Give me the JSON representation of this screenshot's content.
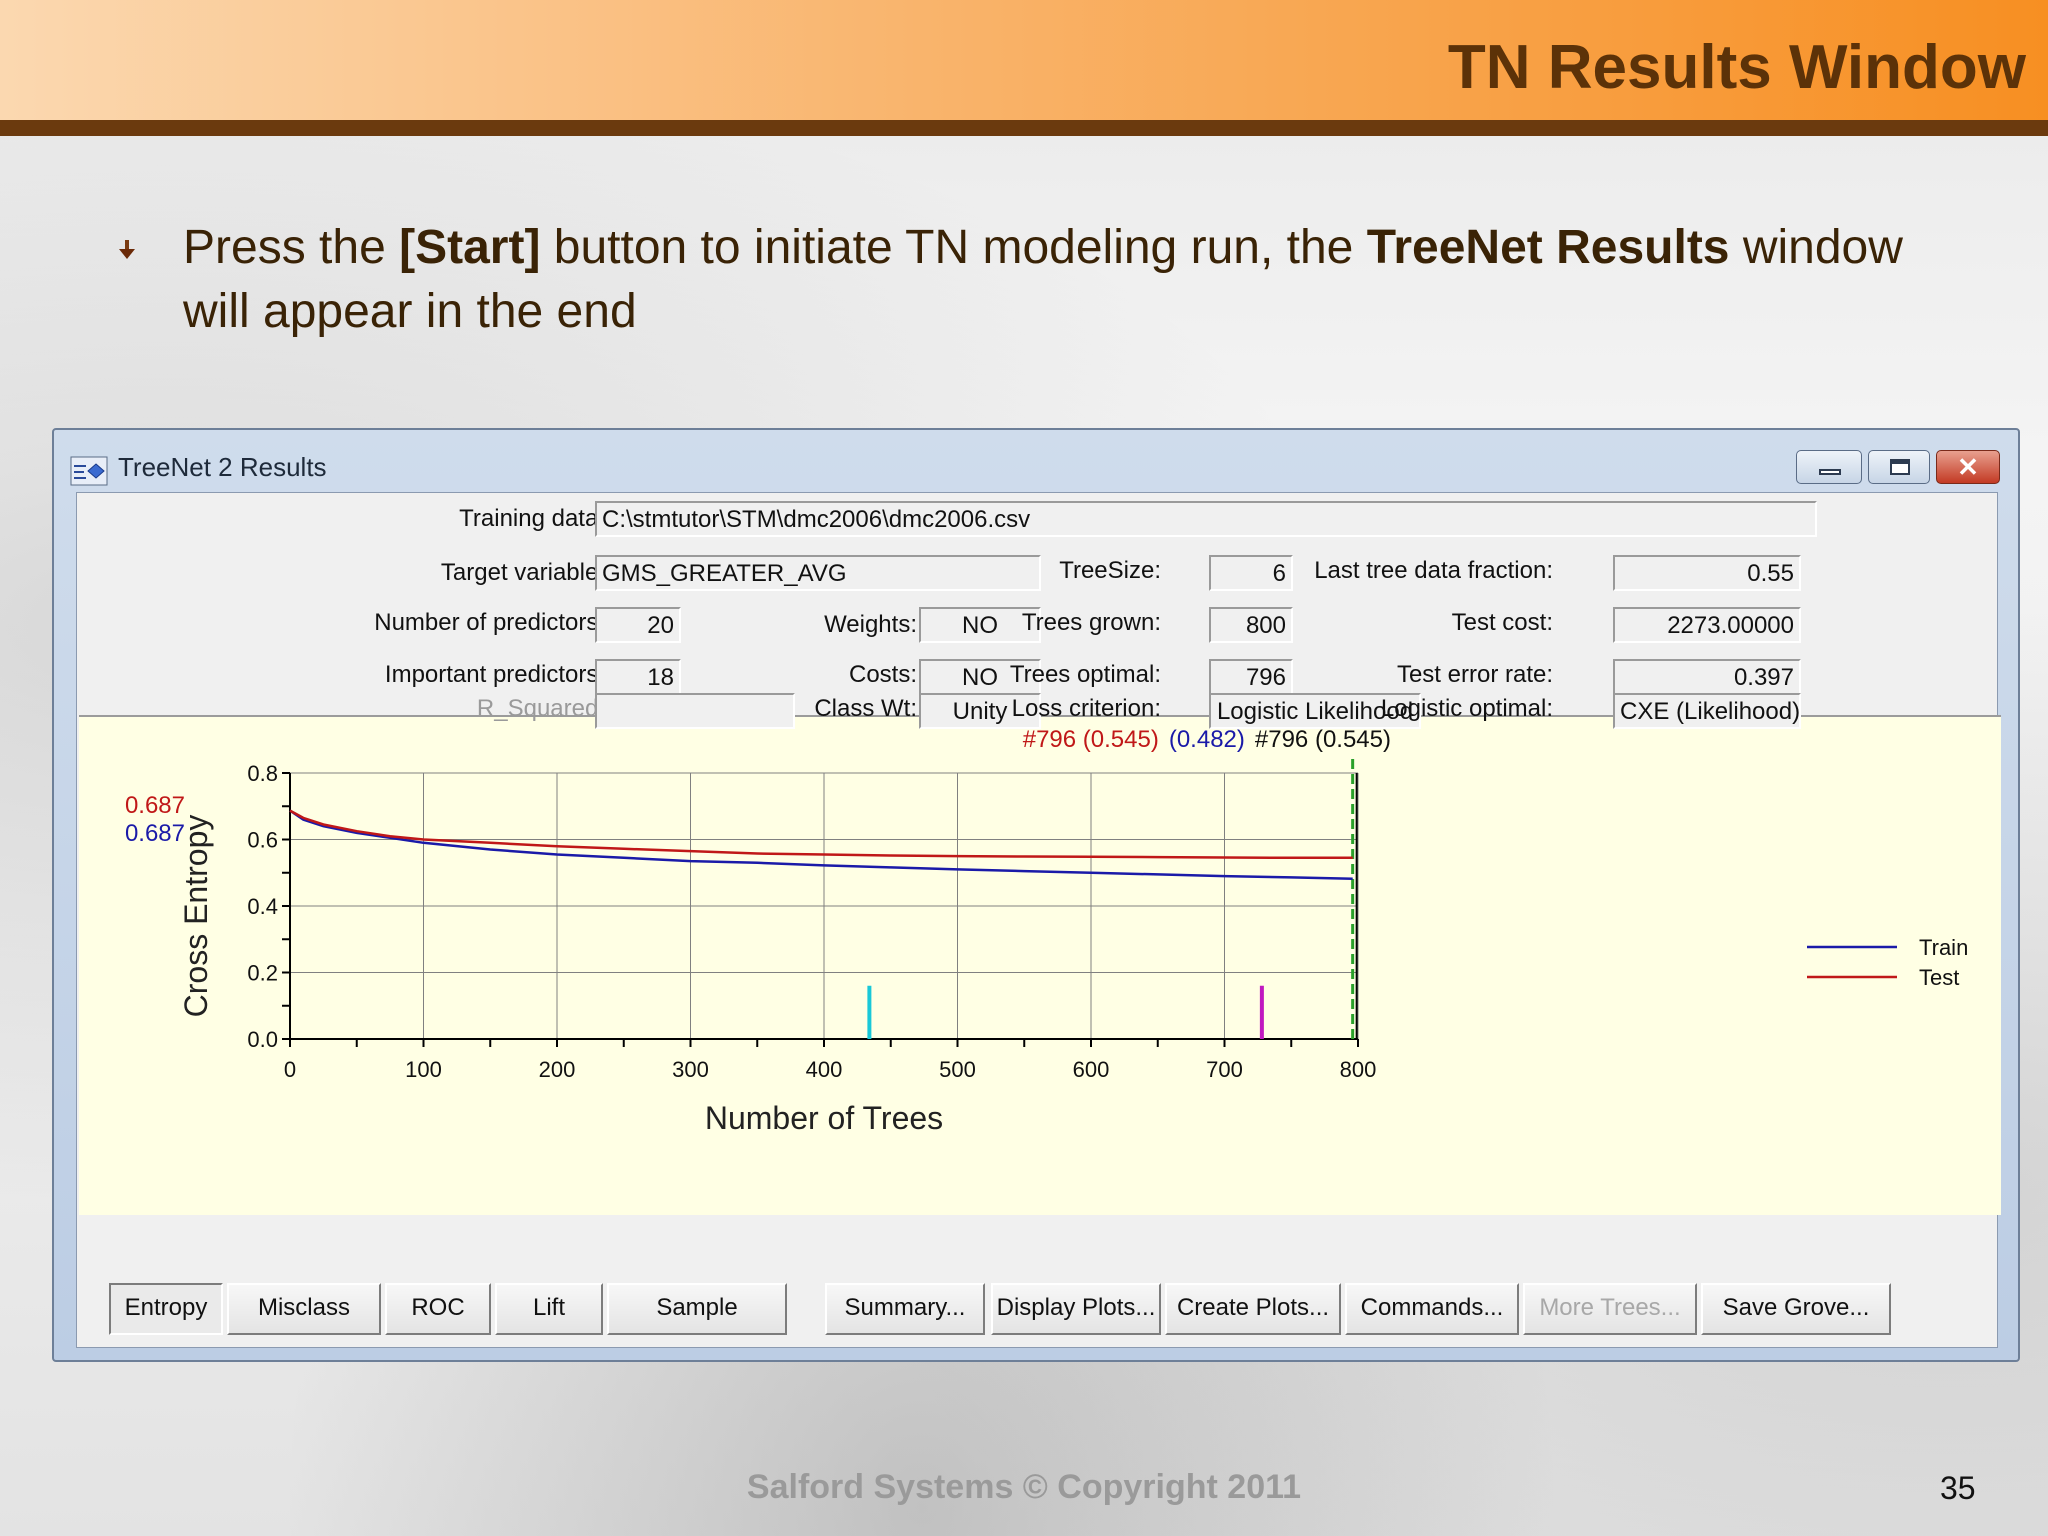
{
  "slide": {
    "title": "TN Results Window",
    "bullet": {
      "part1": "Press the ",
      "bold1": "[Start]",
      "part2": " button to initiate TN modeling run, the ",
      "bold2": "TreeNet Results",
      "part3": " window will appear in the end"
    },
    "footer": "Salford Systems   © Copyright 2011",
    "page_number": "35"
  },
  "window": {
    "title": "TreeNet 2 Results",
    "close_glyph": "✕"
  },
  "fields": {
    "training_data_label": "Training data:",
    "training_data_value": "C:\\stmtutor\\STM\\dmc2006\\dmc2006.csv",
    "target_variable_label": "Target variable:",
    "target_variable_value": "GMS_GREATER_AVG",
    "num_predictors_label": "Number of predictors:",
    "num_predictors_value": "20",
    "important_predictors_label": "Important predictors:",
    "important_predictors_value": "18",
    "r_squared_label": "R_Squared:",
    "r_squared_value": "",
    "weights_label": "Weights:",
    "weights_value": "NO",
    "costs_label": "Costs:",
    "costs_value": "NO",
    "class_wt_label": "Class Wt:",
    "class_wt_value": "Unity",
    "treesize_label": "TreeSize:",
    "treesize_value": "6",
    "trees_grown_label": "Trees grown:",
    "trees_grown_value": "800",
    "trees_optimal_label": "Trees optimal:",
    "trees_optimal_value": "796",
    "loss_criterion_label": "Loss criterion:",
    "loss_criterion_value": "Logistic Likelihood",
    "last_tree_label": "Last tree data fraction:",
    "last_tree_value": "0.55",
    "test_cost_label": "Test cost:",
    "test_cost_value": "2273.00000",
    "test_error_label": "Test error rate:",
    "test_error_value": "0.397",
    "logistic_optimal_label": "Logistic optimal:",
    "logistic_optimal_value": "CXE (Likelihood)"
  },
  "chart_data": {
    "type": "line",
    "xlabel": "Number of Trees",
    "ylabel": "Cross Entropy",
    "xlim": [
      0,
      800
    ],
    "ylim": [
      0.0,
      0.8
    ],
    "x_ticks": [
      "0",
      "100",
      "200",
      "300",
      "400",
      "500",
      "600",
      "700",
      "800"
    ],
    "y_ticks": [
      "0.0",
      "0.2",
      "0.4",
      "0.6",
      "0.8"
    ],
    "grid": true,
    "legend_position": "right",
    "series": [
      {
        "name": "Train",
        "color": "#1a1aa8",
        "x": [
          0,
          10,
          25,
          50,
          75,
          100,
          150,
          200,
          250,
          300,
          350,
          400,
          450,
          500,
          550,
          600,
          650,
          700,
          750,
          796
        ],
        "y": [
          0.687,
          0.66,
          0.64,
          0.62,
          0.605,
          0.59,
          0.57,
          0.555,
          0.545,
          0.535,
          0.53,
          0.522,
          0.516,
          0.51,
          0.505,
          0.5,
          0.495,
          0.49,
          0.486,
          0.482
        ]
      },
      {
        "name": "Test",
        "color": "#c01818",
        "x": [
          0,
          10,
          25,
          50,
          75,
          100,
          150,
          200,
          250,
          300,
          350,
          400,
          450,
          500,
          550,
          600,
          650,
          700,
          750,
          796
        ],
        "y": [
          0.687,
          0.665,
          0.645,
          0.625,
          0.61,
          0.6,
          0.59,
          0.58,
          0.572,
          0.565,
          0.558,
          0.555,
          0.552,
          0.55,
          0.549,
          0.548,
          0.547,
          0.546,
          0.545,
          0.545
        ]
      }
    ],
    "start_labels": [
      {
        "text": "0.687",
        "color": "#c01818"
      },
      {
        "text": "0.687",
        "color": "#1a1aa8"
      }
    ],
    "markers": [
      {
        "x": 434,
        "height": 0.16,
        "color": "#19c8d8"
      },
      {
        "x": 728,
        "height": 0.16,
        "color": "#c019c0"
      }
    ],
    "optimal_line": {
      "x": 796,
      "color": "#2aa02a"
    },
    "annotation": {
      "test_part": "#796  (0.545)",
      "test_color": "#c01818",
      "train_part": "(0.482)",
      "train_color": "#1a1aa8",
      "extra_part": "#796  (0.545)",
      "extra_color": "#111111"
    }
  },
  "buttons": [
    {
      "label": "Entropy",
      "name": "entropy-button",
      "state": "active"
    },
    {
      "label": "Misclass",
      "name": "misclass-button",
      "state": "normal"
    },
    {
      "label": "ROC",
      "name": "roc-button",
      "state": "normal"
    },
    {
      "label": "Lift",
      "name": "lift-button",
      "state": "normal"
    },
    {
      "label": "Sample",
      "name": "sample-button",
      "state": "normal"
    },
    {
      "label": "Summary...",
      "name": "summary-button",
      "state": "normal"
    },
    {
      "label": "Display Plots...",
      "name": "display-plots-button",
      "state": "normal"
    },
    {
      "label": "Create Plots...",
      "name": "create-plots-button",
      "state": "normal"
    },
    {
      "label": "Commands...",
      "name": "commands-button",
      "state": "normal"
    },
    {
      "label": "More Trees...",
      "name": "more-trees-button",
      "state": "disabled"
    },
    {
      "label": "Save Grove...",
      "name": "save-grove-button",
      "state": "normal"
    }
  ]
}
